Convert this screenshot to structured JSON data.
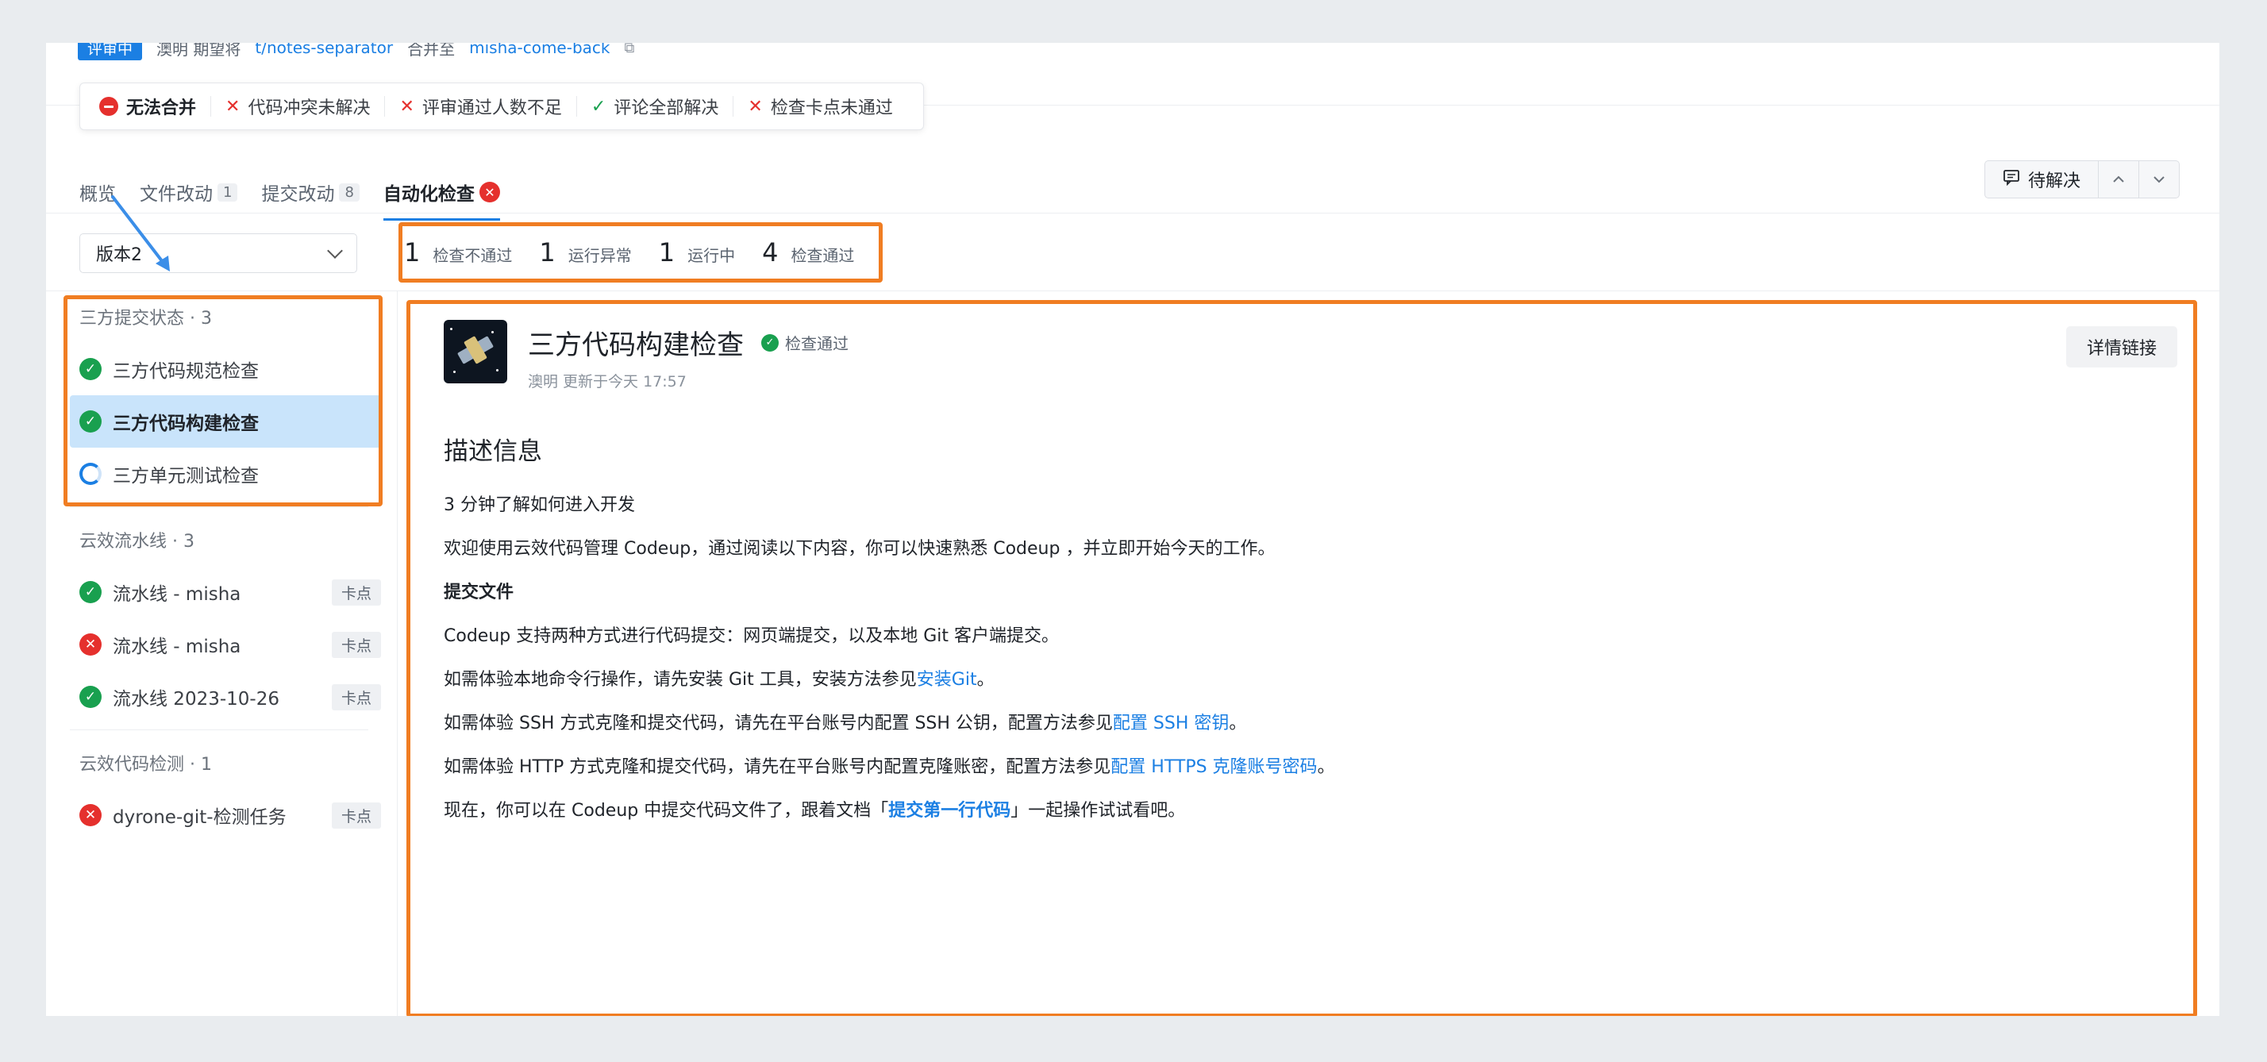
{
  "top_strip": {
    "badge": "评审中",
    "prefix": "澳明 期望将",
    "source_branch": "t/notes-separator",
    "middle": "合并至",
    "target_branch": "misha-come-back"
  },
  "merge_status": {
    "main": "无法合并",
    "items": [
      {
        "state": "fail",
        "label": "代码冲突未解决"
      },
      {
        "state": "fail",
        "label": "评审通过人数不足"
      },
      {
        "state": "ok",
        "label": "评论全部解决"
      },
      {
        "state": "fail",
        "label": "检查卡点未通过"
      }
    ]
  },
  "tabs": [
    {
      "label": "概览",
      "count": ""
    },
    {
      "label": "文件改动",
      "count": "1"
    },
    {
      "label": "提交改动",
      "count": "8"
    },
    {
      "label": "自动化检查",
      "count": "",
      "active": true
    }
  ],
  "pending_button": "待解决",
  "version_select": "版本2",
  "summary": [
    {
      "num": "1",
      "label": "检查不通过"
    },
    {
      "num": "1",
      "label": "运行异常"
    },
    {
      "num": "1",
      "label": "运行中"
    },
    {
      "num": "4",
      "label": "检查通过"
    }
  ],
  "groups": [
    {
      "title": "三方提交状态 · 3",
      "items": [
        {
          "state": "ok",
          "label": "三方代码规范检查",
          "tag": ""
        },
        {
          "state": "ok",
          "label": "三方代码构建检查",
          "tag": "",
          "selected": true
        },
        {
          "state": "run",
          "label": "三方单元测试检查",
          "tag": ""
        }
      ]
    },
    {
      "title": "云效流水线 · 3",
      "items": [
        {
          "state": "ok",
          "label": "流水线 - misha",
          "tag": "卡点"
        },
        {
          "state": "fail",
          "label": "流水线 - misha",
          "tag": "卡点"
        },
        {
          "state": "ok",
          "label": "流水线 2023-10-26",
          "tag": "卡点"
        }
      ]
    },
    {
      "title": "云效代码检测 · 1",
      "items": [
        {
          "state": "fail",
          "label": "dyrone-git-检测任务",
          "tag": "卡点"
        }
      ]
    }
  ],
  "detail": {
    "title": "三方代码构建检查",
    "status": "检查通过",
    "meta": "澳明 更新于今天 17:57",
    "link_button": "详情链接",
    "heading": "描述信息",
    "p1": "3 分钟了解如何进入开发",
    "p2": "欢迎使用云效代码管理 Codeup，通过阅读以下内容，你可以快速熟悉 Codeup ，并立即开始今天的工作。",
    "p3": "提交文件",
    "p4": "Codeup 支持两种方式进行代码提交：网页端提交，以及本地 Git 客户端提交。",
    "p5_pre": "如需体验本地命令行操作，请先安装 Git 工具，安装方法参见",
    "p5_link": "安装Git",
    "p5_post": "。",
    "p6_pre": "如需体验 SSH 方式克隆和提交代码，请先在平台账号内配置 SSH 公钥，配置方法参见",
    "p6_link": "配置 SSH 密钥",
    "p6_post": "。",
    "p7_pre": "如需体验 HTTP 方式克隆和提交代码，请先在平台账号内配置克隆账密，配置方法参见",
    "p7_link": "配置 HTTPS 克隆账号密码",
    "p7_post": "。",
    "p8_pre": "现在，你可以在 Codeup 中提交代码文件了，跟着文档「",
    "p8_link": "提交第一行代码",
    "p8_post": "」一起操作试试看吧。"
  },
  "colors": {
    "accent": "#1b7fe3",
    "annotation": "#f07d22",
    "ok": "#19a04f",
    "fail": "#e5302d",
    "selected_bg": "#c9e4fb"
  }
}
